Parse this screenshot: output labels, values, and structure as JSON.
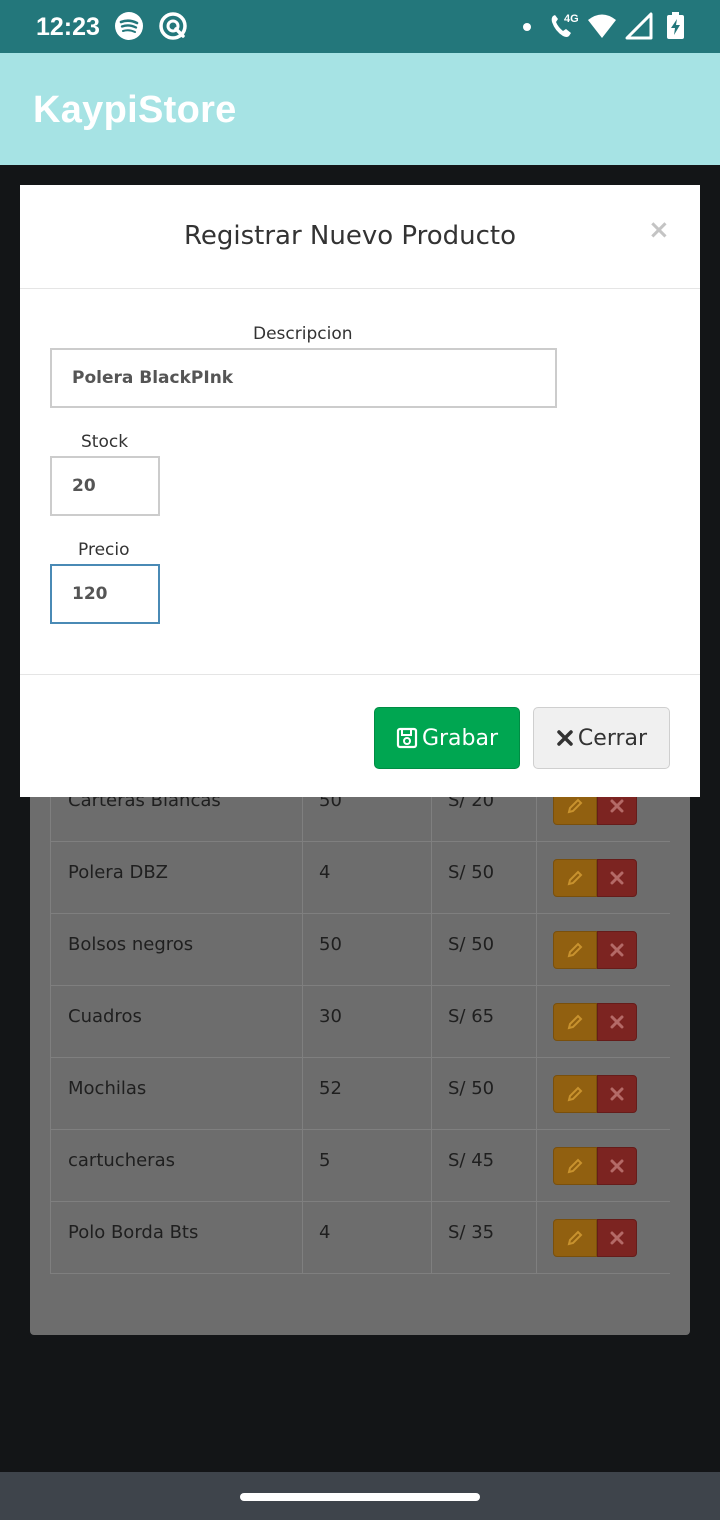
{
  "status_bar": {
    "time": "12:23",
    "icons": [
      "spotify-icon",
      "app-icon",
      "dot-icon",
      "call-4g-icon",
      "wifi-icon",
      "signal-icon",
      "battery-charging-icon"
    ],
    "network_label": "4G"
  },
  "app_bar": {
    "title": "KaypiStore"
  },
  "table": {
    "rows": [
      {
        "name": "Carteras Blancas",
        "stock": "50",
        "price": "S/ 20"
      },
      {
        "name": "Polera DBZ",
        "stock": "4",
        "price": "S/ 50"
      },
      {
        "name": "Bolsos negros",
        "stock": "50",
        "price": "S/ 50"
      },
      {
        "name": "Cuadros",
        "stock": "30",
        "price": "S/ 65"
      },
      {
        "name": "Mochilas",
        "stock": "52",
        "price": "S/ 50"
      },
      {
        "name": "cartucheras",
        "stock": "5",
        "price": "S/ 45"
      },
      {
        "name": "Polo Borda Bts",
        "stock": "4",
        "price": "S/ 35"
      }
    ],
    "edit_icon": "pencil-icon",
    "delete_icon": "x-icon"
  },
  "modal": {
    "title": "Registrar Nuevo Producto",
    "close_glyph": "×",
    "fields": {
      "descripcion": {
        "label": "Descripcion",
        "value": "Polera BlackPInk"
      },
      "stock": {
        "label": "Stock",
        "value": "20"
      },
      "precio": {
        "label": "Precio",
        "value": "120"
      }
    },
    "save_label": "Grabar",
    "cancel_label": "Cerrar"
  },
  "colors": {
    "status_bar": "#23777b",
    "app_bar": "#a6e3e4",
    "save_button": "#00a651",
    "focus_border": "#4a8ab5"
  }
}
